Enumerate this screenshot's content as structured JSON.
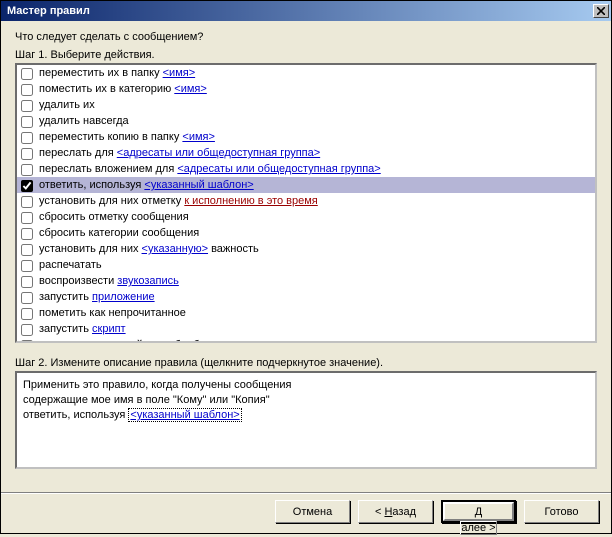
{
  "window": {
    "title": "Мастер правил"
  },
  "step1": {
    "prompt": "Что следует сделать с сообщением?",
    "label": "Шаг 1. Выберите действия."
  },
  "actions": [
    {
      "checked": false,
      "selected": false,
      "pre": "переместить их в папку ",
      "link": "<имя>",
      "post": "",
      "linkClass": "link"
    },
    {
      "checked": false,
      "selected": false,
      "pre": "поместить их в категорию ",
      "link": "<имя>",
      "post": "",
      "linkClass": "link"
    },
    {
      "checked": false,
      "selected": false,
      "pre": "удалить их",
      "link": "",
      "post": "",
      "linkClass": ""
    },
    {
      "checked": false,
      "selected": false,
      "pre": "удалить навсегда",
      "link": "",
      "post": "",
      "linkClass": ""
    },
    {
      "checked": false,
      "selected": false,
      "pre": "переместить копию в папку ",
      "link": "<имя>",
      "post": "",
      "linkClass": "link"
    },
    {
      "checked": false,
      "selected": false,
      "pre": "переслать для ",
      "link": "<адресаты или общедоступная группа>",
      "post": "",
      "linkClass": "link"
    },
    {
      "checked": false,
      "selected": false,
      "pre": "переслать вложением для ",
      "link": "<адресаты или общедоступная группа>",
      "post": "",
      "linkClass": "link"
    },
    {
      "checked": true,
      "selected": true,
      "pre": "ответить, используя ",
      "link": "<указанный шаблон>",
      "post": "",
      "linkClass": "link"
    },
    {
      "checked": false,
      "selected": false,
      "pre": "установить для них отметку ",
      "link": "к исполнению в это время",
      "post": "",
      "linkClass": "link red"
    },
    {
      "checked": false,
      "selected": false,
      "pre": "сбросить отметку сообщения",
      "link": "",
      "post": "",
      "linkClass": ""
    },
    {
      "checked": false,
      "selected": false,
      "pre": "сбросить категории сообщения",
      "link": "",
      "post": "",
      "linkClass": ""
    },
    {
      "checked": false,
      "selected": false,
      "pre": "установить для них ",
      "link": "<указанную>",
      "post": " важность",
      "linkClass": "link"
    },
    {
      "checked": false,
      "selected": false,
      "pre": "распечатать",
      "link": "",
      "post": "",
      "linkClass": ""
    },
    {
      "checked": false,
      "selected": false,
      "pre": "воспроизвести ",
      "link": "звукозапись",
      "post": "",
      "linkClass": "link"
    },
    {
      "checked": false,
      "selected": false,
      "pre": "запустить ",
      "link": "приложение",
      "post": "",
      "linkClass": "link"
    },
    {
      "checked": false,
      "selected": false,
      "pre": "пометить как непрочитанное",
      "link": "",
      "post": "",
      "linkClass": ""
    },
    {
      "checked": false,
      "selected": false,
      "pre": "запустить ",
      "link": "скрипт",
      "post": "",
      "linkClass": "link"
    },
    {
      "checked": false,
      "selected": false,
      "pre": "остановить дальнейшую обработку правил",
      "link": "",
      "post": "",
      "linkClass": ""
    }
  ],
  "step2": {
    "label": "Шаг 2. Измените описание правила (щелкните подчеркнутое значение).",
    "line1": "Применить это правило, когда получены сообщения",
    "line2": "содержащие мое имя в поле \"Кому\" или \"Копия\"",
    "line3_pre": "ответить, используя ",
    "line3_link": "<указанный шаблон>"
  },
  "buttons": {
    "cancel": "Отмена",
    "back_pre": "< ",
    "back_u": "Н",
    "back_post": "азад",
    "next_u": "Д",
    "next_post": "алее >",
    "finish": "Готово"
  }
}
